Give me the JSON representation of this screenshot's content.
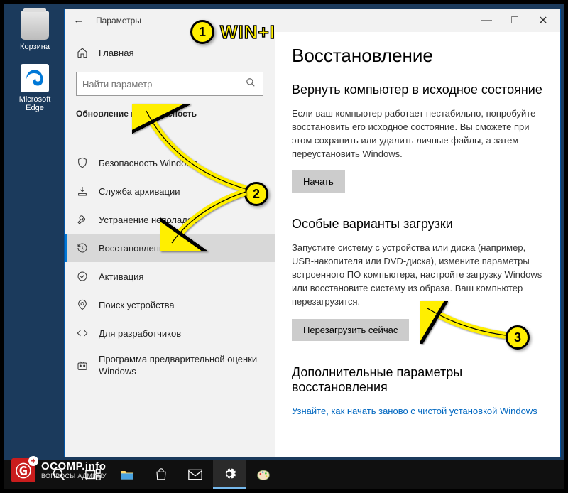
{
  "desktop": {
    "icons": [
      {
        "label": "Корзина"
      },
      {
        "label": "Microsoft Edge"
      }
    ]
  },
  "window": {
    "title": "Параметры",
    "back_tooltip": "Назад"
  },
  "sidebar": {
    "home_label": "Главная",
    "search_placeholder": "Найти параметр",
    "section_title": "Обновление и безопасность",
    "items": [
      {
        "label": "Безопасность Windows"
      },
      {
        "label": "Служба архивации"
      },
      {
        "label": "Устранение неполадок"
      },
      {
        "label": "Восстановление"
      },
      {
        "label": "Активация"
      },
      {
        "label": "Поиск устройства"
      },
      {
        "label": "Для разработчиков"
      },
      {
        "label": "Программа предварительной оценки Windows"
      }
    ]
  },
  "content": {
    "page_title": "Восстановление",
    "reset": {
      "heading": "Вернуть компьютер в исходное состояние",
      "body": "Если ваш компьютер работает нестабильно, попробуйте восстановить его исходное состояние. Вы сможете при этом сохранить или удалить личные файлы, а затем переустановить Windows.",
      "button": "Начать"
    },
    "advanced": {
      "heading": "Особые варианты загрузки",
      "body": "Запустите систему с устройства или диска (например, USB-накопителя или DVD-диска), измените параметры встроенного ПО компьютера, настройте загрузку Windows или восстановите систему из образа. Ваш компьютер перезагрузится.",
      "button": "Перезагрузить сейчас"
    },
    "more": {
      "heading": "Дополнительные параметры восстановления",
      "link": "Узнайте, как начать заново с чистой установкой Windows"
    }
  },
  "annotations": {
    "step1_num": "1",
    "step1_text": "WIN+I",
    "step2_num": "2",
    "step3_num": "3"
  },
  "watermark": {
    "site": "OCOMP.info",
    "tagline": "ВОПРОСЫ АДМИНУ"
  }
}
